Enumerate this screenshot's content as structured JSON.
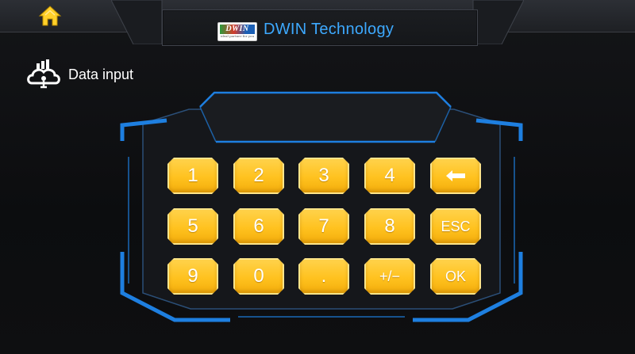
{
  "header": {
    "brand_logo_text": "DWIN",
    "brand_logo_tagline": "ideal partner for you",
    "title": "DWIN Technology"
  },
  "section": {
    "heading": "Data input"
  },
  "keypad": {
    "display_value": "",
    "keys": {
      "k1": "1",
      "k2": "2",
      "k3": "3",
      "k4": "4",
      "backspace": "",
      "k5": "5",
      "k6": "6",
      "k7": "7",
      "k8": "8",
      "esc": "ESC",
      "k9": "9",
      "k0": "0",
      "dot": ".",
      "sign": "+/−",
      "ok": "OK"
    }
  },
  "colors": {
    "accent_blue": "#3da9ff",
    "frame_blue": "#1e7fe0",
    "key_yellow": "#ffc21f",
    "icon_yellow": "#ffd02a",
    "background": "#0e0f11"
  },
  "icons": {
    "home": "home-icon",
    "data_input": "cloud-data-icon",
    "backspace": "arrow-left-icon"
  }
}
